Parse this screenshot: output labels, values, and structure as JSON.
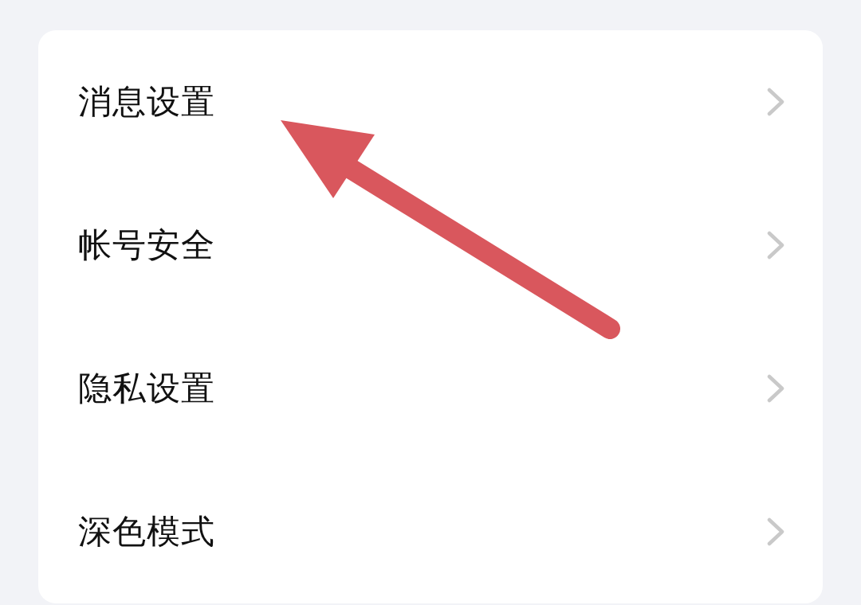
{
  "settings_list": {
    "items": [
      {
        "label": "消息设置"
      },
      {
        "label": "帐号安全"
      },
      {
        "label": "隐私设置"
      },
      {
        "label": "深色模式"
      }
    ]
  }
}
